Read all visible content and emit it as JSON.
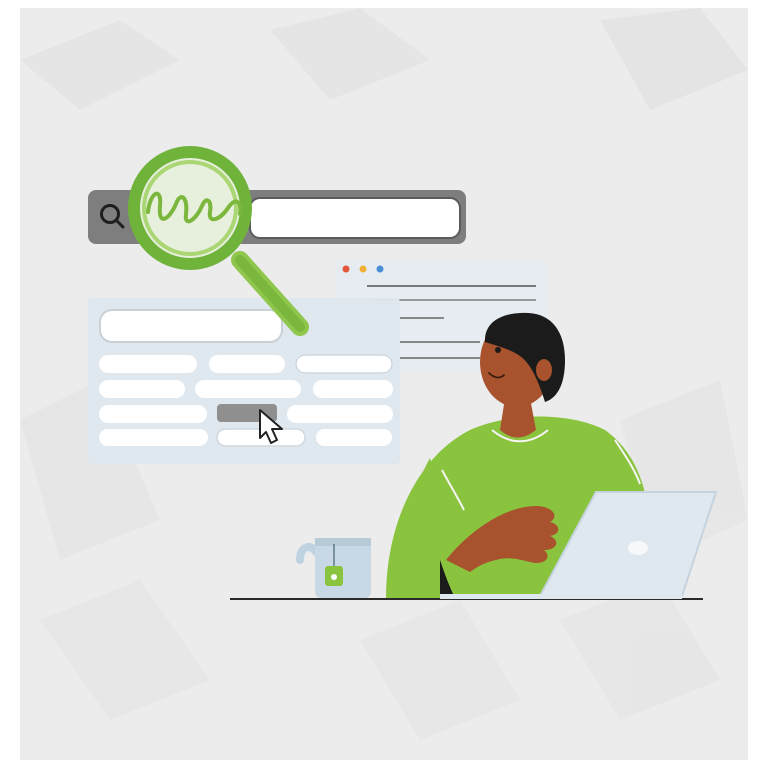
{
  "illustration": {
    "subject": "person-using-search-and-form-ui",
    "colors": {
      "background": "#ececec",
      "accent_green": "#8ac43f",
      "magnifier_green": "#6fb33a",
      "skin": "#a8522e",
      "hair": "#1b1b1b",
      "ui_panel": "#dfe7ee",
      "field_white": "#ffffff",
      "search_bar": "#808080",
      "laptop": "#dfe8ef",
      "mug": "#bfd2e0",
      "pointer": "#5a5a5a"
    },
    "icons": [
      "search-icon",
      "magnifying-glass-icon",
      "cursor-icon",
      "mug-icon",
      "laptop-icon"
    ],
    "search_bar": {
      "handwriting_glyph": "scribble-text"
    },
    "browser_window": {
      "dots": [
        "#e4563b",
        "#f2b134",
        "#4a8fd6"
      ]
    }
  }
}
